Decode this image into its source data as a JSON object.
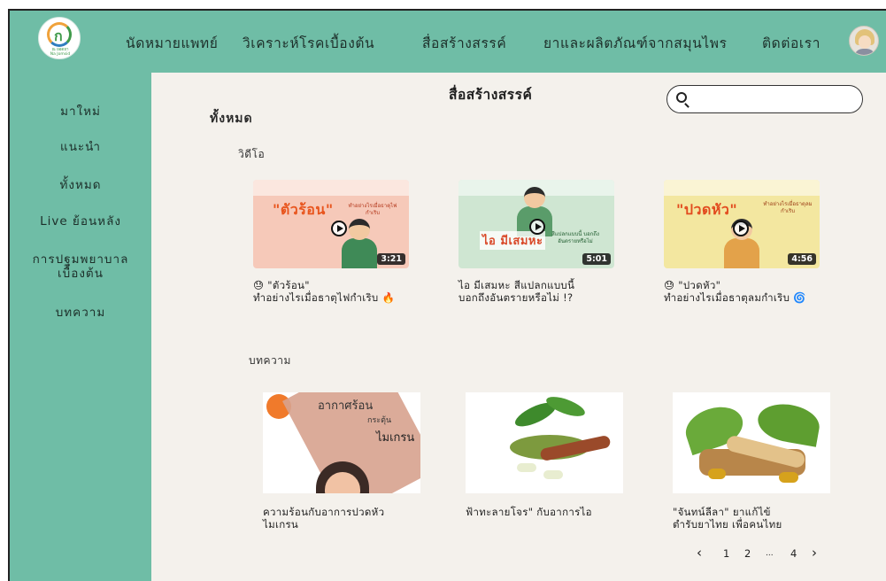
{
  "app": {
    "logo_text": "ณ ยอดยา\nNa Jomsid",
    "nav": [
      {
        "label": "นัดหมายแพทย์"
      },
      {
        "label": "วิเคราะห์โรคเบื้องต้น"
      },
      {
        "label": "สื่อสร้างสรรค์"
      },
      {
        "label": "ยาและผลิตภัณฑ์จากสมุนไพร"
      },
      {
        "label": "ติดต่อเรา"
      }
    ]
  },
  "sidebar": {
    "items": [
      {
        "label": "มาใหม่"
      },
      {
        "label": "แนะนำ"
      },
      {
        "label": "ทั้งหมด"
      },
      {
        "label": "Live ย้อนหลัง"
      },
      {
        "label": "การปฐมพยาบาล\nเบื้องต้น"
      },
      {
        "label": "บทความ"
      }
    ]
  },
  "main": {
    "page_title": "สื่อสร้างสรรค์",
    "search": {
      "placeholder": "",
      "value": ""
    },
    "section_all": "ทั้งหมด",
    "videos_label": "วิดีโอ",
    "articles_label": "บทความ",
    "videos": [
      {
        "thumb_headline": "\"ตัวร้อน\"",
        "thumb_sub": "ทำอย่างไรเมื่อธาตุไฟกำเริบ",
        "duration": "3:21",
        "title": "😓 \"ตัวร้อน\"\nทำอย่างไรเมื่อธาตุไฟกำเริบ 🔥",
        "bg": "#f6c9b9",
        "accent": "#e8541c"
      },
      {
        "thumb_headline": "ไอ มีเสมหะ",
        "thumb_sub": "สีแปลกแบบนี้ บอกถึงอันตรายหรือไม่",
        "duration": "5:01",
        "title": "ไอ มีเสมหะ สีแปลกแบบนี้\nบอกถึงอันตรายหรือไม่ !?",
        "bg": "#cfe6d2",
        "accent": "#d94a2a"
      },
      {
        "thumb_headline": "\"ปวดหัว\"",
        "thumb_sub": "ทำอย่างไรเมื่อธาตุลมกำเริบ",
        "duration": "4:56",
        "title": "😓 \"ปวดหัว\"\nทำอย่างไรเมื่อธาตุลมกำเริบ 🌀",
        "bg": "#f3e7a0",
        "accent": "#e24a1e"
      }
    ],
    "articles": [
      {
        "thumb_text_1": "อากาศร้อน",
        "thumb_text_2": "กระตุ้น",
        "thumb_text_3": "ไมเกรน",
        "title": "ความร้อนกับอาการปวดหัว\nไมเกรน"
      },
      {
        "title": "ฟ้าทะลายโจร\" กับอาการไอ"
      },
      {
        "title": "\"จันทน์ลีลา\" ยาแก้ไข้\nตำรับยาไทย เพื่อคนไทย"
      }
    ],
    "pagination": {
      "prev": "‹",
      "pages": [
        "1",
        "2",
        "...",
        "4"
      ],
      "next": "›"
    }
  },
  "colors": {
    "header_bg": "#6fbda6",
    "main_bg": "#f4f1ec"
  }
}
